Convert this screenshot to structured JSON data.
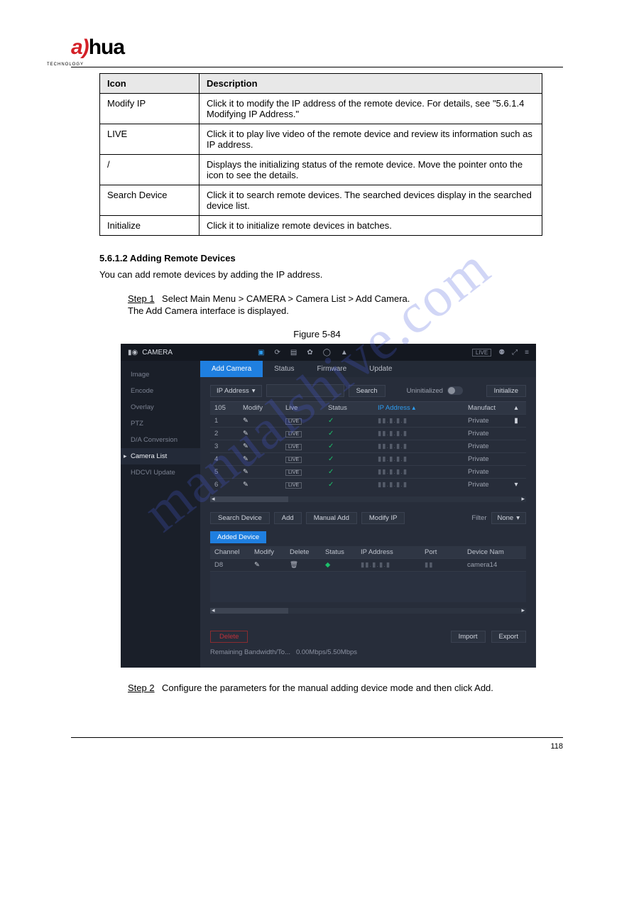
{
  "logo": {
    "part1": "a)",
    "part2": "hua",
    "sub": "TECHNOLOGY"
  },
  "table": {
    "headers": [
      "Icon",
      "Description"
    ],
    "rows": [
      {
        "icon": "Modify IP",
        "desc": "Click it to modify the IP address of the remote device. For details, see \"5.6.1.4 Modifying IP Address.\""
      },
      {
        "icon": "LIVE",
        "desc": "Click it to play live video of the remote device and review its information such as IP address."
      },
      {
        "icon": " / ",
        "desc": "Displays the initializing status of the remote device. Move the pointer onto the icon to see the details."
      },
      {
        "icon": "Search Device",
        "desc": "Click it to search remote devices. The searched devices display in the searched device list."
      },
      {
        "icon": "Initialize",
        "desc": "Click it to initialize remote devices in batches."
      }
    ]
  },
  "section": {
    "title": "5.6.1.2 Adding Remote Devices",
    "desc": "You can add remote devices by adding the IP address.",
    "step1_label": "Step 1",
    "step1_text": "Select Main Menu > CAMERA > Camera List > Add Camera.",
    "step1_result": "The Add Camera interface is displayed.",
    "figure_caption": "Figure 5-84",
    "step2_label": "Step 2",
    "step2_text": "Configure the parameters for the manual adding device mode and then click Add."
  },
  "shot": {
    "title": "CAMERA",
    "header_right": {
      "live": "LIVE"
    },
    "sidebar": [
      "Image",
      "Encode",
      "Overlay",
      "PTZ",
      "D/A Conversion",
      "Camera List",
      "HDCVI Update"
    ],
    "sidebar_active_index": 5,
    "tabs": [
      "Add Camera",
      "Status",
      "Firmware",
      "Update"
    ],
    "tabs_active_index": 0,
    "search_row": {
      "select_label": "IP Address",
      "search_btn": "Search",
      "uninit_label": "Uninitialized",
      "init_btn": "Initialize"
    },
    "grid_headers": [
      "105",
      "Modify",
      "Live",
      "Status",
      "IP Address",
      "Manufact"
    ],
    "grid_rows": [
      {
        "n": "1",
        "mfr": "Private"
      },
      {
        "n": "2",
        "mfr": "Private"
      },
      {
        "n": "3",
        "mfr": "Private"
      },
      {
        "n": "4",
        "mfr": "Private"
      },
      {
        "n": "5",
        "mfr": "Private"
      },
      {
        "n": "6",
        "mfr": "Private"
      }
    ],
    "btn_row": {
      "search_device": "Search Device",
      "add": "Add",
      "manual_add": "Manual Add",
      "modify_ip": "Modify IP",
      "filter_label": "Filter",
      "filter_value": "None"
    },
    "added_tab": "Added Device",
    "grid2_headers": [
      "Channel",
      "Modify",
      "Delete",
      "Status",
      "IP Address",
      "Port",
      "Device Nam"
    ],
    "grid2_row": {
      "channel": "D8",
      "devname": "camera14"
    },
    "bottom": {
      "delete": "Delete",
      "import": "Import",
      "export": "Export",
      "bw": "Remaining Bandwidth/To...",
      "bw_val": "0.00Mbps/5.50Mbps"
    }
  },
  "watermark": "manualshive.com",
  "footer": "118"
}
